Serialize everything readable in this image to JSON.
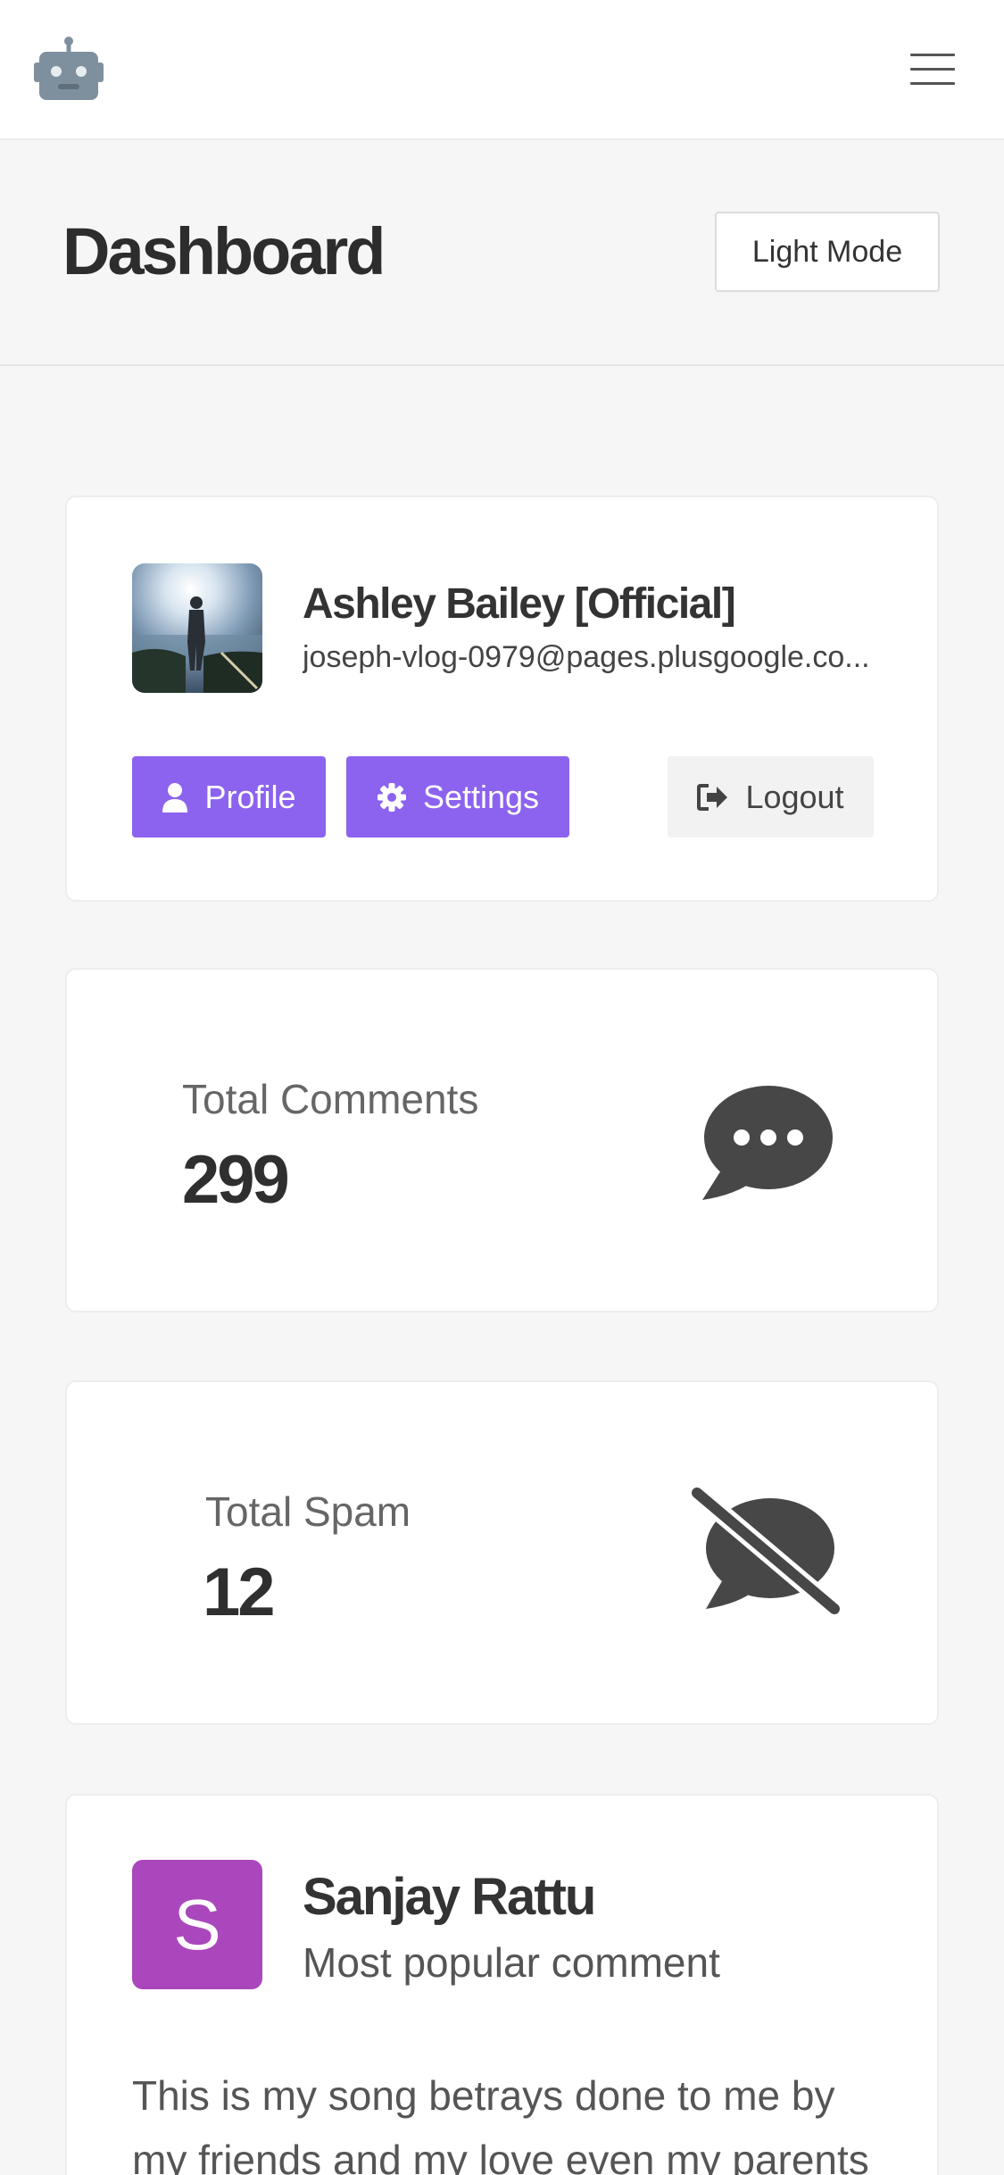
{
  "header": {
    "page_title": "Dashboard",
    "mode_button_label": "Light Mode"
  },
  "profile": {
    "name": "Ashley Bailey [Official]",
    "email": "joseph-vlog-0979@pages.plusgoogle.co...",
    "buttons": {
      "profile_label": "Profile",
      "settings_label": "Settings",
      "logout_label": "Logout"
    },
    "button_color": "#8c63ef"
  },
  "stats": [
    {
      "label": "Total Comments",
      "value": "299",
      "icon": "comment-dots-icon"
    },
    {
      "label": "Total Spam",
      "value": "12",
      "icon": "comment-slash-icon"
    }
  ],
  "popular_comment": {
    "avatar_letter": "S",
    "avatar_color": "#ab47bc",
    "author": "Sanjay Rattu",
    "subtitle": "Most popular comment",
    "text": "This is my song betrays done to me by my friends and my love even my parents"
  }
}
